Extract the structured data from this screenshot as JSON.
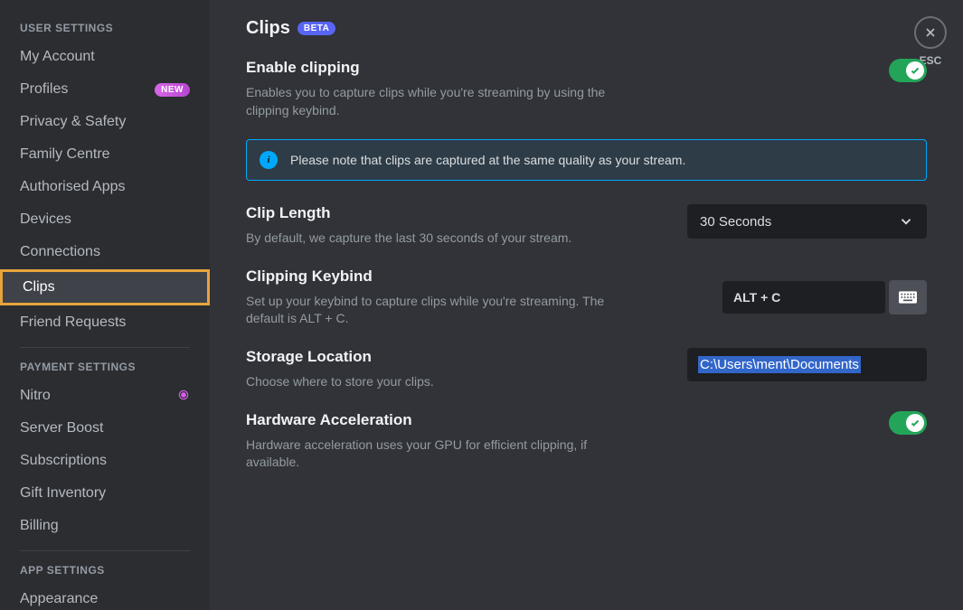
{
  "sidebar": {
    "sections": [
      {
        "header": "USER SETTINGS",
        "items": [
          {
            "label": "My Account"
          },
          {
            "label": "Profiles",
            "badge": "NEW"
          },
          {
            "label": "Privacy & Safety"
          },
          {
            "label": "Family Centre"
          },
          {
            "label": "Authorised Apps"
          },
          {
            "label": "Devices"
          },
          {
            "label": "Connections"
          },
          {
            "label": "Clips",
            "selected": true,
            "highlighted": true
          },
          {
            "label": "Friend Requests"
          }
        ]
      },
      {
        "header": "PAYMENT SETTINGS",
        "items": [
          {
            "label": "Nitro",
            "nitro_icon": true
          },
          {
            "label": "Server Boost"
          },
          {
            "label": "Subscriptions"
          },
          {
            "label": "Gift Inventory"
          },
          {
            "label": "Billing"
          }
        ]
      },
      {
        "header": "APP SETTINGS",
        "items": [
          {
            "label": "Appearance"
          }
        ]
      }
    ]
  },
  "page": {
    "title": "Clips",
    "beta_label": "BETA"
  },
  "close": {
    "label": "ESC"
  },
  "enable": {
    "title": "Enable clipping",
    "desc": "Enables you to capture clips while you're streaming by using the clipping keybind."
  },
  "notice": {
    "text": "Please note that clips are captured at the same quality as your stream."
  },
  "clip_length": {
    "title": "Clip Length",
    "desc": "By default, we capture the last 30 seconds of your stream.",
    "value": "30 Seconds"
  },
  "keybind": {
    "title": "Clipping Keybind",
    "desc": "Set up your keybind to capture clips while you're streaming. The default is ALT + C.",
    "value": "ALT + C"
  },
  "storage": {
    "title": "Storage Location",
    "desc": "Choose where to store your clips.",
    "value": "C:\\Users\\ment\\Documents"
  },
  "hw_accel": {
    "title": "Hardware Acceleration",
    "desc": "Hardware acceleration uses your GPU for efficient clipping, if available."
  }
}
